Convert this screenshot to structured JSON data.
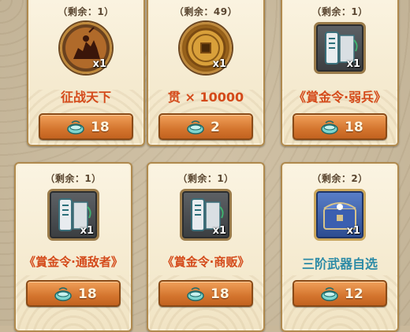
{
  "colors": {
    "name_red": "#d44a1a",
    "name_teal": "#2b8aa6",
    "button": "#d4752e"
  },
  "items": [
    {
      "remaining": "（剩余：1）",
      "quantity": "x1",
      "name": "征战天下",
      "price": "18",
      "icon": "war-rider-icon"
    },
    {
      "remaining": "（剩余：49）",
      "quantity": "x1",
      "name": "贯 × 10000",
      "price": "2",
      "icon": "coin-icon"
    },
    {
      "remaining": "（剩余：1）",
      "quantity": "x1",
      "name": "《賞金令·弱兵》",
      "price": "18",
      "icon": "bounty-scroll-icon"
    },
    {
      "remaining": "（剩余：1）",
      "quantity": "x1",
      "name": "《賞金令·通敌者》",
      "price": "18",
      "icon": "bounty-scroll-icon"
    },
    {
      "remaining": "（剩余：1）",
      "quantity": "x1",
      "name": "《賞金令·商贩》",
      "price": "18",
      "icon": "bounty-scroll-icon"
    },
    {
      "remaining": "（剩余：2）",
      "quantity": "x1",
      "name": "三阶武器自选",
      "price": "12",
      "icon": "treasure-chest-icon"
    }
  ]
}
